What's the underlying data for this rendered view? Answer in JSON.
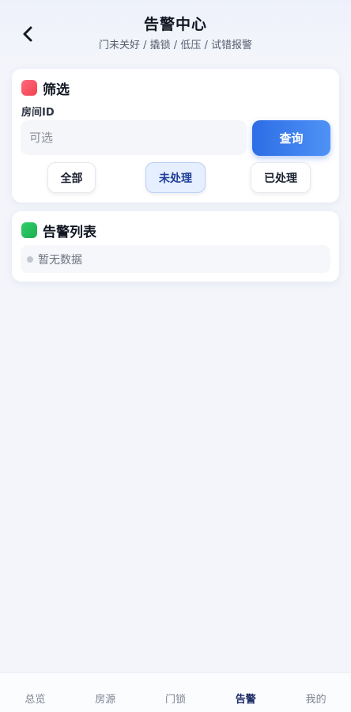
{
  "header": {
    "title": "告警中心",
    "subtitle": "门未关好 / 撬锁 / 低压 / 试错报警",
    "back_icon": "chevron-left-icon"
  },
  "filter": {
    "heading": "筛选",
    "heading_color": "#f2414f",
    "room_label": "房间ID",
    "room_value": "",
    "room_placeholder": "可选",
    "query_label": "查询",
    "query_color": "#2d6de6",
    "segments": [
      {
        "label": "全部",
        "active": false
      },
      {
        "label": "未处理",
        "active": true
      },
      {
        "label": "已处理",
        "active": false
      }
    ]
  },
  "alarm_list": {
    "heading": "告警列表",
    "heading_color": "#1fae52",
    "empty_text": "暂无数据"
  },
  "tabbar": {
    "items": [
      {
        "label": "总览",
        "active": false
      },
      {
        "label": "房源",
        "active": false
      },
      {
        "label": "门锁",
        "active": false
      },
      {
        "label": "告警",
        "active": true
      },
      {
        "label": "我的",
        "active": false
      }
    ],
    "active_color": "#1c2a66"
  }
}
